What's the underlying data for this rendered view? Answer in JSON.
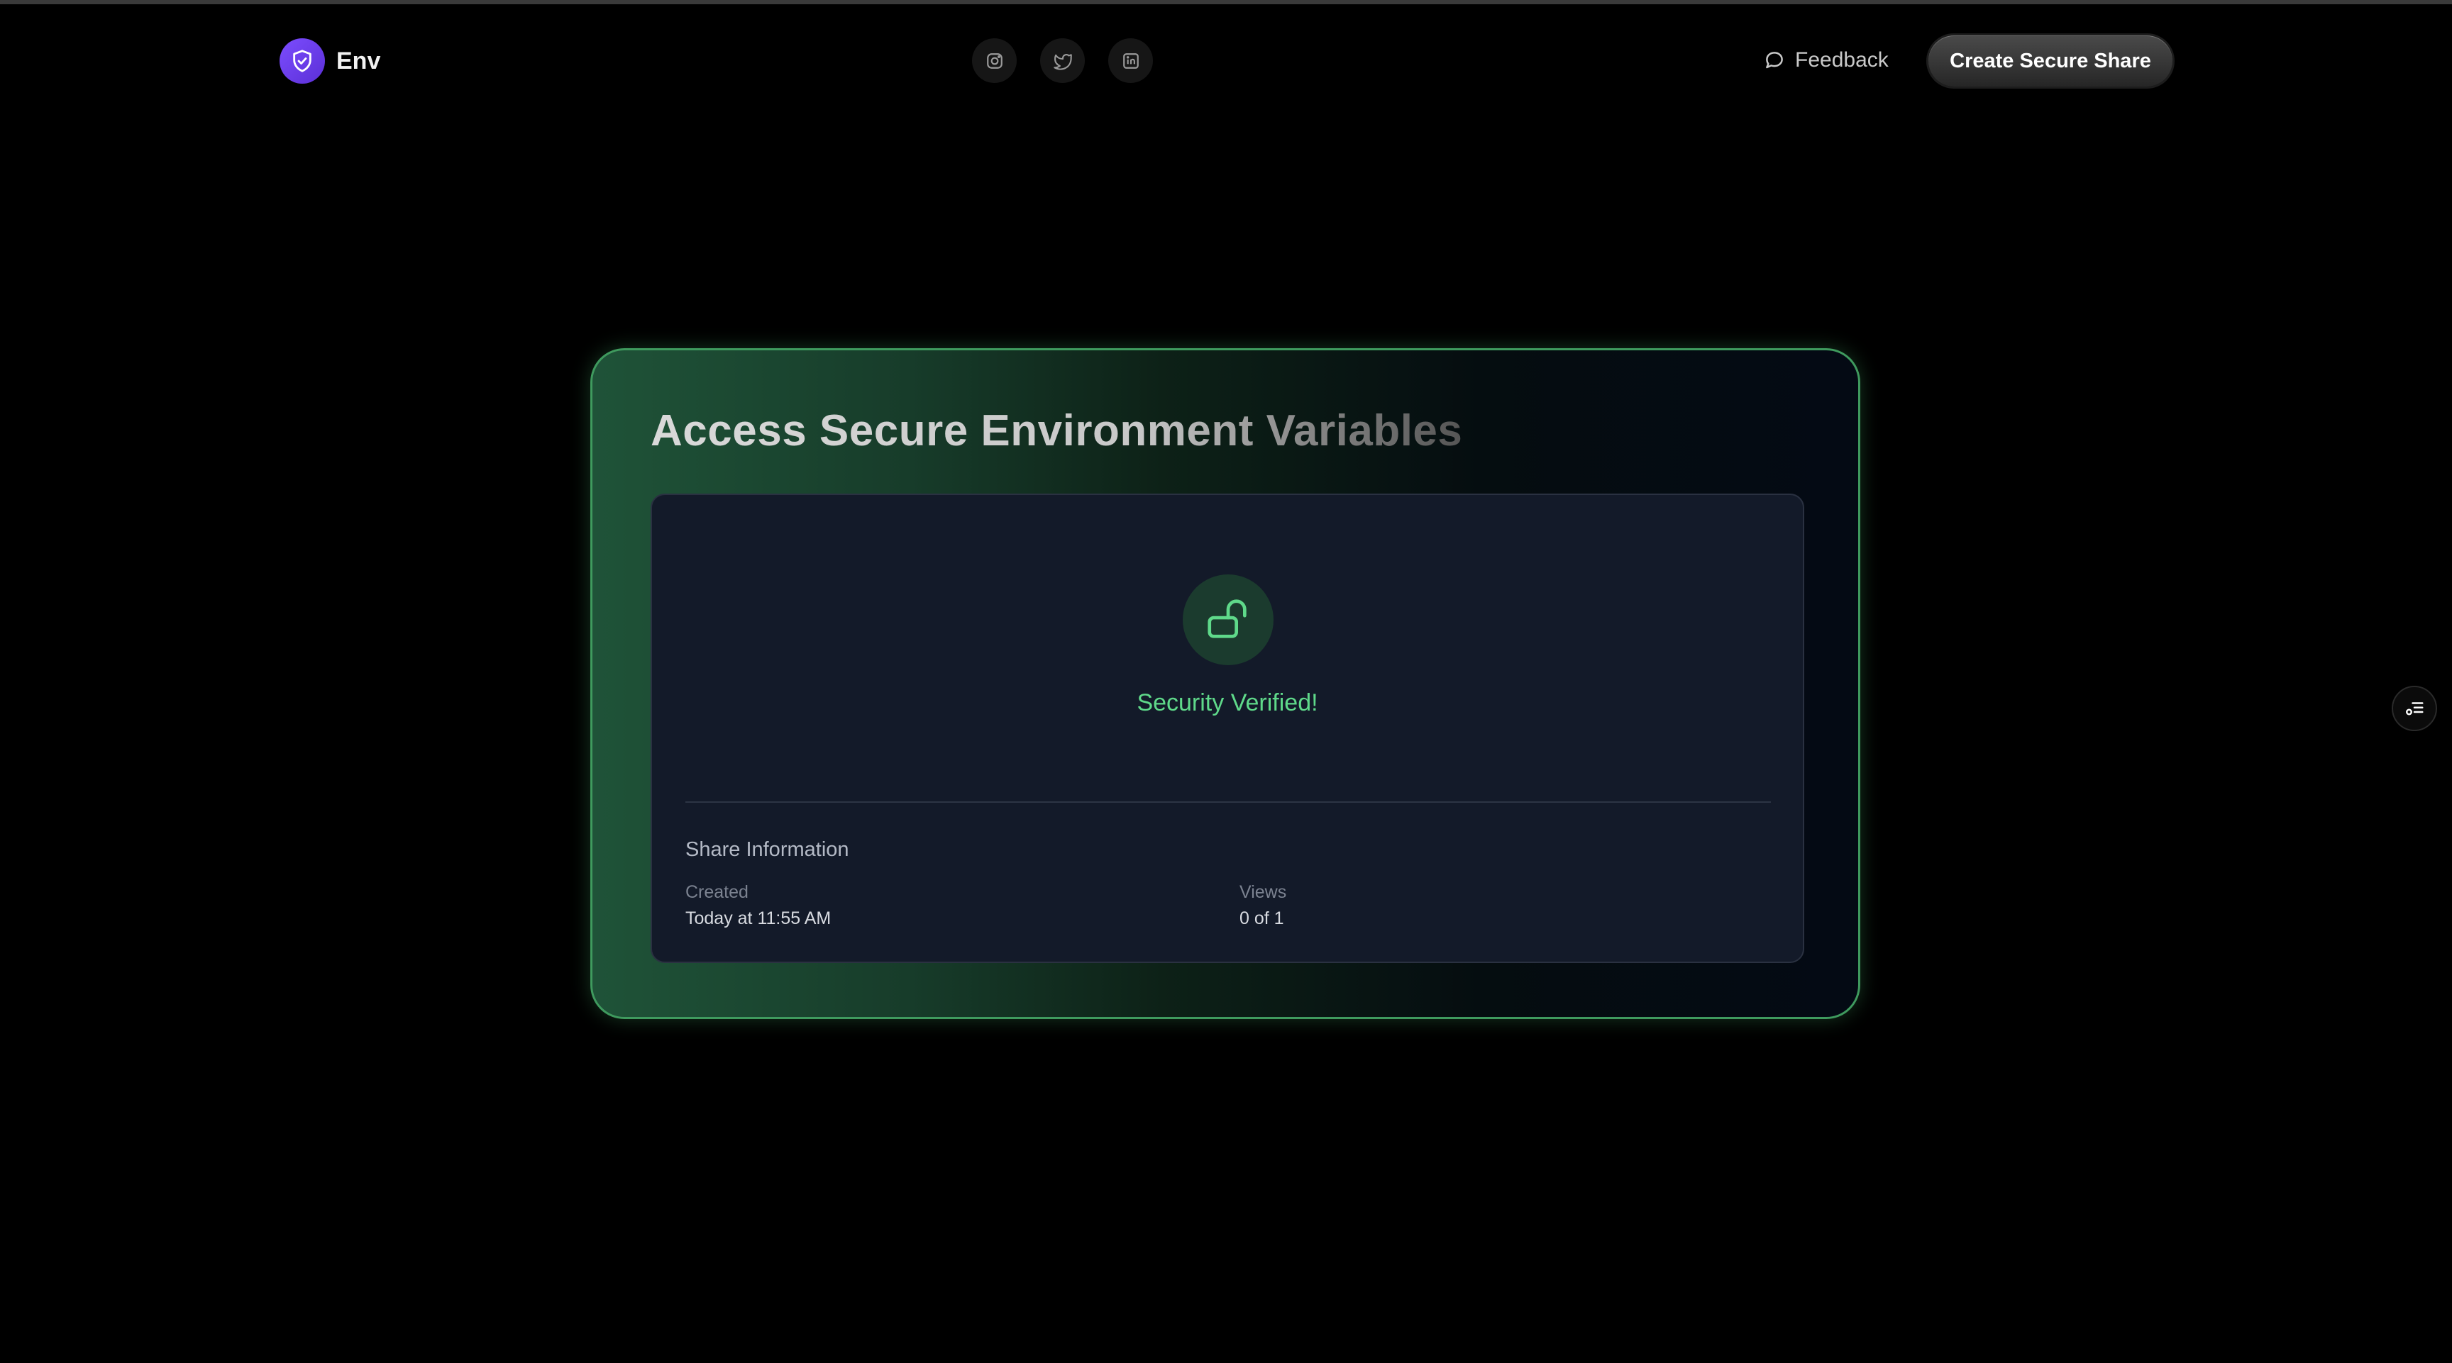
{
  "brand": {
    "name": "Env"
  },
  "header": {
    "socials": [
      {
        "icon": "instagram-icon"
      },
      {
        "icon": "twitter-icon"
      },
      {
        "icon": "linkedin-icon"
      }
    ],
    "feedback_label": "Feedback",
    "cta_label": "Create Secure Share"
  },
  "card": {
    "title": "Access Secure Environment Variables",
    "status_text": "Security Verified!",
    "info": {
      "title": "Share Information",
      "created_label": "Created",
      "created_value": "Today at 11:55 AM",
      "views_label": "Views",
      "views_value": "0 of 1"
    }
  },
  "colors": {
    "background": "#000000",
    "accent_green": "#5fd98a",
    "brand_purple": "#6d3ff0",
    "card_border": "#3f9a5e"
  }
}
